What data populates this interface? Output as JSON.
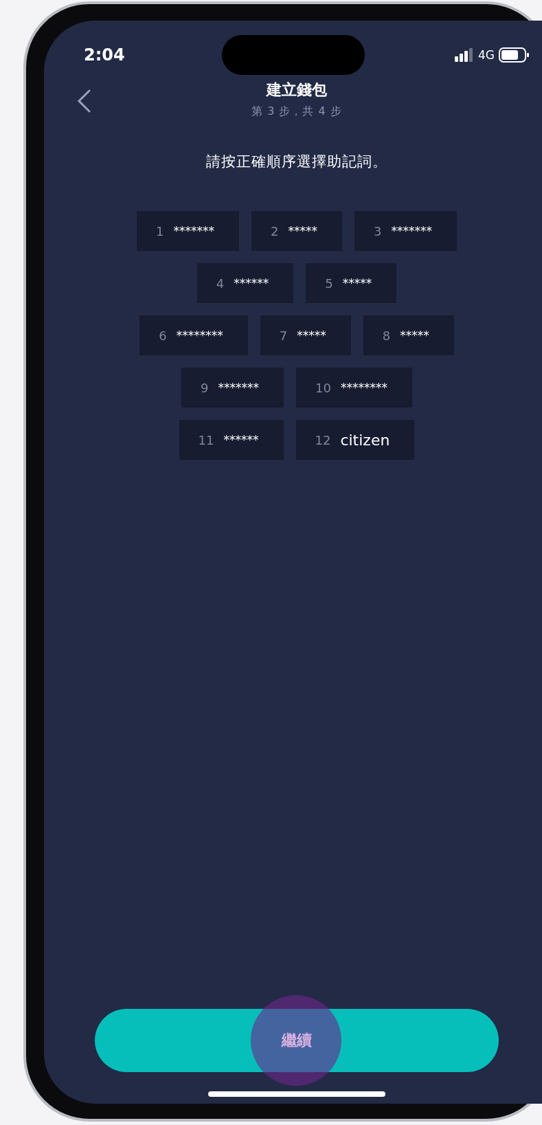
{
  "status_bar": {
    "time": "2:04",
    "network": "4G"
  },
  "header": {
    "title": "建立錢包",
    "subtitle": "第 3 步，共 4 步"
  },
  "instruction": "請按正確順序選擇助記詞。",
  "word_rows": [
    [
      {
        "number": "1",
        "word": "*******",
        "kind": "masked"
      },
      {
        "number": "2",
        "word": "*****",
        "kind": "masked"
      },
      {
        "number": "3",
        "word": "*******",
        "kind": "masked"
      }
    ],
    [
      {
        "number": "4",
        "word": "******",
        "kind": "masked"
      },
      {
        "number": "5",
        "word": "*****",
        "kind": "masked"
      }
    ],
    [
      {
        "number": "6",
        "word": "********",
        "kind": "masked"
      },
      {
        "number": "7",
        "word": "*****",
        "kind": "masked"
      },
      {
        "number": "8",
        "word": "*****",
        "kind": "masked"
      }
    ],
    [
      {
        "number": "9",
        "word": "*******",
        "kind": "masked"
      },
      {
        "number": "10",
        "word": "********",
        "kind": "masked"
      }
    ],
    [
      {
        "number": "11",
        "word": "******",
        "kind": "masked"
      },
      {
        "number": "12",
        "word": "citizen",
        "kind": "revealed"
      }
    ]
  ],
  "continue_button": {
    "label": "繼續"
  }
}
